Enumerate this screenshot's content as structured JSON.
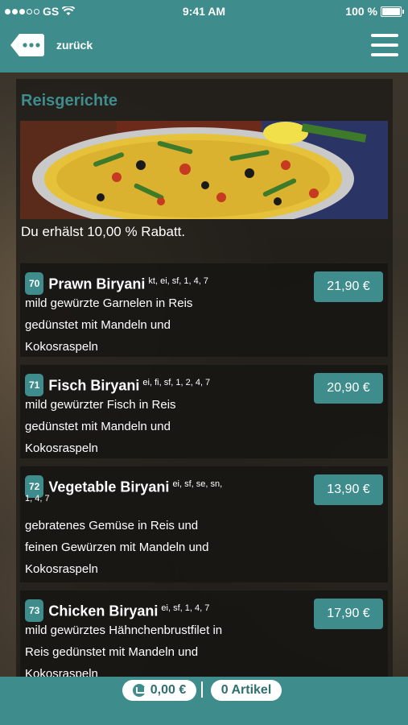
{
  "status_bar": {
    "carrier": "GS",
    "time": "9:41 AM",
    "battery": "100 %"
  },
  "nav": {
    "back_label": "zurück",
    "back_icon": "ellipsis-tag-icon",
    "menu_icon": "hamburger-icon"
  },
  "section": {
    "title": "Reisgerichte",
    "discount_text": "Du erhälst 10,00 % Rabatt."
  },
  "items": [
    {
      "number": "70",
      "name": "Prawn Biryani",
      "allergens": "kt, ei, sf, 1, 4, 7",
      "desc_lines": [
        "mild gewürzte Garnelen in Reis",
        "gedünstet mit Mandeln und",
        "Kokosraspeln"
      ],
      "price": "21,90 €"
    },
    {
      "number": "71",
      "name": "Fisch Biryani",
      "allergens": "ei, fi, sf, 1, 2, 4, 7",
      "desc_lines": [
        "mild gewürzter Fisch in Reis",
        "gedünstet mit Mandeln und",
        "Kokosraspeln"
      ],
      "price": "20,90 €"
    },
    {
      "number": "72",
      "name": "Vegetable Biryani",
      "allergens": "ei, sf, se, sn,",
      "allergens_line2": "1, 4, 7",
      "desc_lines": [
        "gebratenes Gemüse in Reis und",
        "feinen Gewürzen mit Mandeln und",
        "Kokosraspeln"
      ],
      "price": "13,90 €"
    },
    {
      "number": "73",
      "name": "Chicken Biryani",
      "allergens": "ei, sf, 1, 4, 7",
      "desc_lines": [
        "mild gewürztes Hähnchenbrustfilet in",
        "Reis gedünstet mit Mandeln und",
        "Kokosraspeln"
      ],
      "price": "17,90 €"
    }
  ],
  "bottom_bar": {
    "cart_total": "0,00 €",
    "cart_icon": "cart-icon",
    "item_count": "0 Artikel"
  },
  "colors": {
    "accent": "#3f8c8c"
  }
}
